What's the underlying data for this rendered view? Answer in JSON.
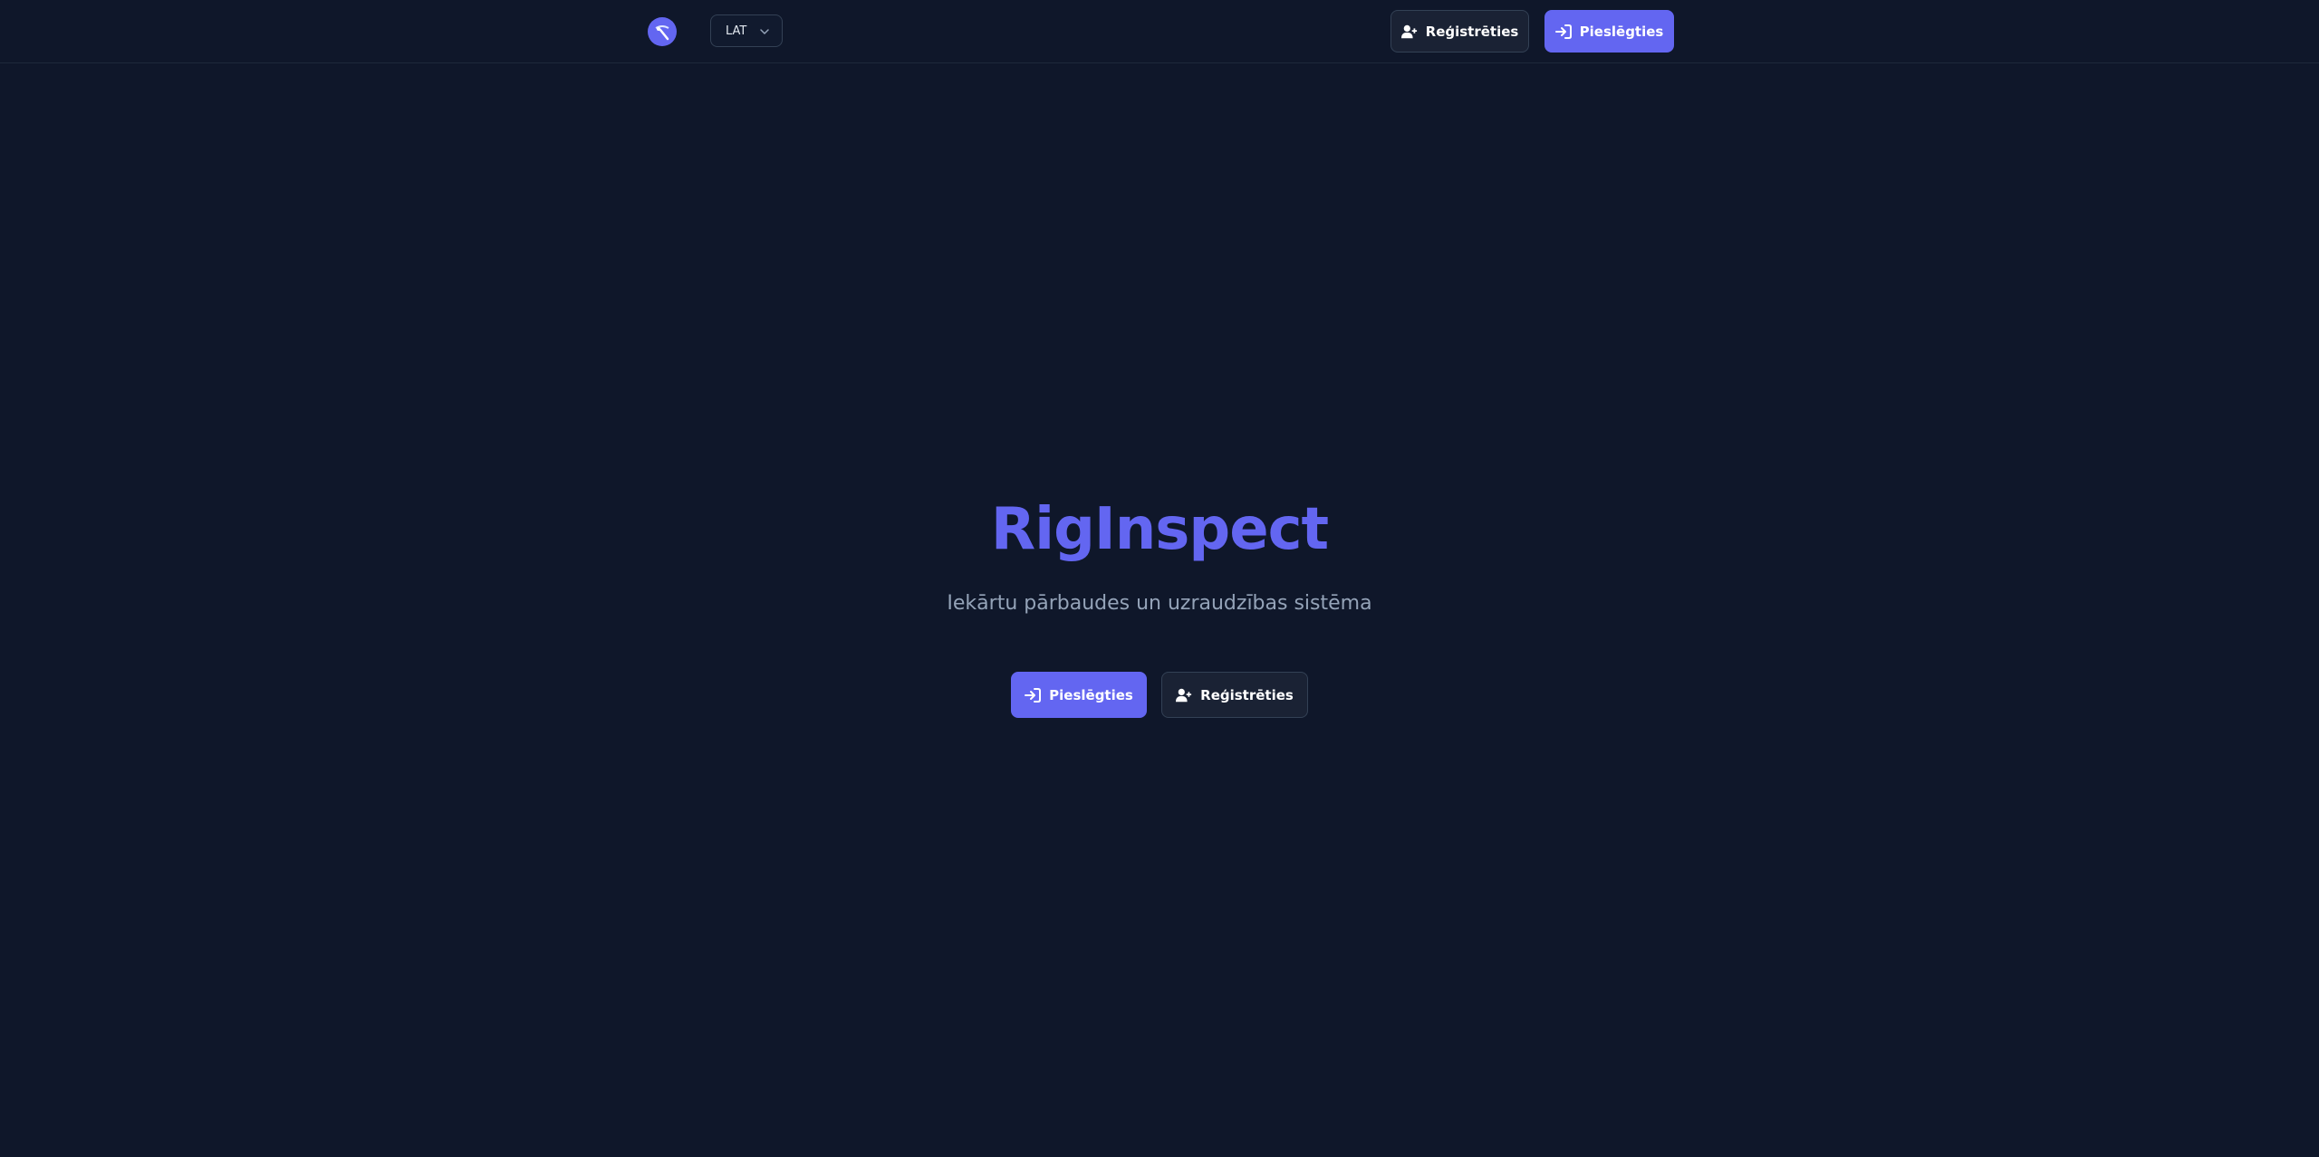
{
  "header": {
    "logo_icon": "app-logo-icon",
    "language": {
      "selected": "LAT",
      "icon": "chevron-down-icon"
    },
    "register_button": {
      "label": "Reģistrēties",
      "icon": "user-plus-icon"
    },
    "login_button": {
      "label": "Pieslēgties",
      "icon": "login-arrow-icon"
    }
  },
  "hero": {
    "title": "RigInspect",
    "subtitle": "Iekārtu pārbaudes un uzraudzības sistēma",
    "login_button": {
      "label": "Pieslēgties",
      "icon": "login-arrow-icon"
    },
    "register_button": {
      "label": "Reģistrēties",
      "icon": "user-plus-icon"
    }
  },
  "colors": {
    "background": "#0f172a",
    "accent": "#6366f1",
    "subtitle": "#94a3b8",
    "secondary_button": "#1a2234",
    "border": "#334155"
  }
}
